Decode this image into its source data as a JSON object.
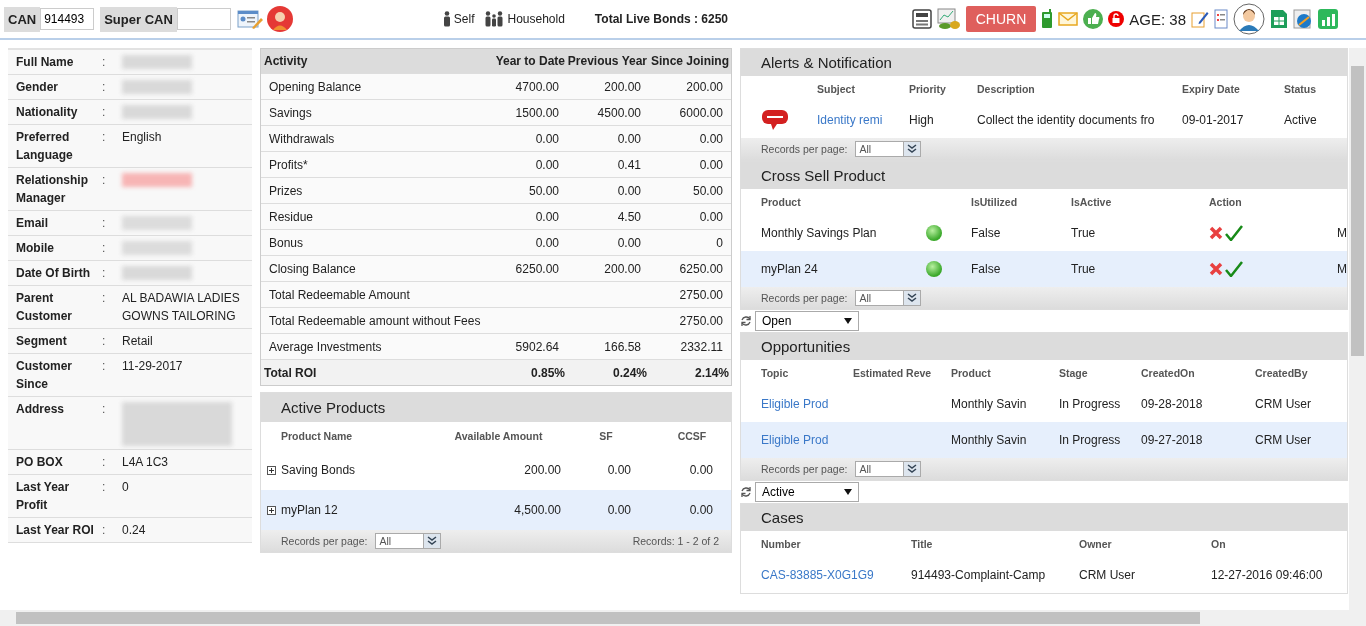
{
  "header": {
    "profile_separator": ":",
    "can_label": "CAN",
    "can_value": "914493",
    "super_can_label": "Super CAN",
    "self": "Self",
    "household": "Household",
    "total_live_bonds": "Total Live Bonds : 6250",
    "churn": "CHURN",
    "age": "AGE: 38"
  },
  "profile": [
    {
      "label": "Full Name",
      "kind": "redacted",
      "color": "#d9d9d9"
    },
    {
      "label": "Gender",
      "kind": "redacted",
      "color": "#d9d9d9"
    },
    {
      "label": "Nationality",
      "kind": "redacted",
      "color": "#d9d9d9"
    },
    {
      "label": "Preferred Language",
      "kind": "text",
      "value": "English"
    },
    {
      "label": "Relationship Manager",
      "kind": "redacted",
      "color": "#f7b5b5"
    },
    {
      "label": "Email",
      "kind": "redacted",
      "color": "#dcdcdc"
    },
    {
      "label": "Mobile",
      "kind": "redacted",
      "color": "#dcdcdc"
    },
    {
      "label": "Date Of Birth",
      "kind": "redacted",
      "color": "#d9d9d9"
    },
    {
      "label": "Parent Customer",
      "kind": "text",
      "value": "AL BADAWIA LADIES GOWNS TAILORING"
    },
    {
      "label": "Segment",
      "kind": "text",
      "value": "Retail"
    },
    {
      "label": "Customer Since",
      "kind": "text",
      "value": "11-29-2017"
    },
    {
      "label": "Address",
      "kind": "redacted_block",
      "color": "#d9d9d9"
    },
    {
      "label": "PO BOX",
      "kind": "text",
      "value": "L4A 1C3"
    },
    {
      "label": "Last Year Profit",
      "kind": "text",
      "value": "0"
    },
    {
      "label": "Last Year ROI",
      "kind": "text",
      "value": "0.24"
    }
  ],
  "activity": {
    "columns": [
      "Activity",
      "Year to Date",
      "Previous Year",
      "Since Joining"
    ],
    "rows": [
      [
        "Opening Balance",
        "4700.00",
        "200.00",
        "200.00"
      ],
      [
        "Savings",
        "1500.00",
        "4500.00",
        "6000.00"
      ],
      [
        "Withdrawals",
        "0.00",
        "0.00",
        "0.00"
      ],
      [
        "Profits*",
        "0.00",
        "0.41",
        "0.00"
      ],
      [
        "Prizes",
        "50.00",
        "0.00",
        "50.00"
      ],
      [
        "Residue",
        "0.00",
        "4.50",
        "0.00"
      ],
      [
        "Bonus",
        "0.00",
        "0.00",
        "0"
      ],
      [
        "Closing Balance",
        "6250.00",
        "200.00",
        "6250.00"
      ],
      [
        "Total Redeemable Amount",
        null,
        null,
        "2750.00"
      ],
      [
        "Total Redeemable amount without Fees",
        null,
        null,
        "2750.00"
      ],
      [
        "Average Investments",
        "5902.64",
        "166.58",
        "2332.11"
      ]
    ],
    "total": [
      "Total ROI",
      "0.85%",
      "0.24%",
      "2.14%"
    ]
  },
  "active_products": {
    "title": "Active Products",
    "columns": [
      "Product Name",
      "Available Amount",
      "SF",
      "CCSF"
    ],
    "rows": [
      {
        "name": "Saving Bonds",
        "amount": "200.00",
        "sf": "0.00",
        "ccsf": "0.00",
        "selected": false
      },
      {
        "name": "myPlan 12",
        "amount": "4,500.00",
        "sf": "0.00",
        "ccsf": "0.00",
        "selected": true
      }
    ],
    "pager_label": "Records per page:",
    "page_size": "All",
    "records": "Records: 1 - 2 of 2"
  },
  "alerts": {
    "title": "Alerts & Notification",
    "columns": [
      "Subject",
      "Priority",
      "Description",
      "Expiry Date",
      "Status"
    ],
    "rows": [
      {
        "subject": "Identity remi",
        "priority": "High",
        "description": "Collect the identity documents fro",
        "expiry": "09-01-2017",
        "status": "Active"
      }
    ],
    "pager_label": "Records per page:",
    "page_size": "All"
  },
  "cross_sell": {
    "title": "Cross Sell Product",
    "columns": [
      "Product",
      "IsUtilized",
      "IsActive",
      "Action"
    ],
    "rows": [
      {
        "product": "Monthly Savings Plan",
        "utilized": "False",
        "active": "True",
        "column_5": "M",
        "selected": false
      },
      {
        "product": "myPlan 24",
        "utilized": "False",
        "active": "True",
        "column_5": "M",
        "selected": true
      }
    ],
    "pager_label": "Records per page:",
    "page_size": "All",
    "filter": "Open"
  },
  "opportunities": {
    "title": "Opportunities",
    "columns": [
      "Topic",
      "Estimated Reve",
      "Product",
      "Stage",
      "CreatedOn",
      "CreatedBy"
    ],
    "rows": [
      {
        "topic": "Eligible Prod",
        "product": "Monthly Savin",
        "stage": "In Progress",
        "created_on": "09-28-2018",
        "created_by": "CRM User",
        "selected": false
      },
      {
        "topic": "Eligible Prod",
        "product": "Monthly Savin",
        "stage": "In Progress",
        "created_on": "09-27-2018",
        "created_by": "CRM User",
        "selected": true
      }
    ],
    "pager_label": "Records per page:",
    "page_size": "All",
    "filter": "Active"
  },
  "cases": {
    "title": "Cases",
    "columns": [
      "Number",
      "Title",
      "Owner",
      "On"
    ],
    "rows": [
      {
        "number": "CAS-83885-X0G1G9",
        "title": "914493-Complaint-Camp",
        "owner": "CRM User",
        "on": "12-27-2016 09:46:00"
      }
    ]
  }
}
